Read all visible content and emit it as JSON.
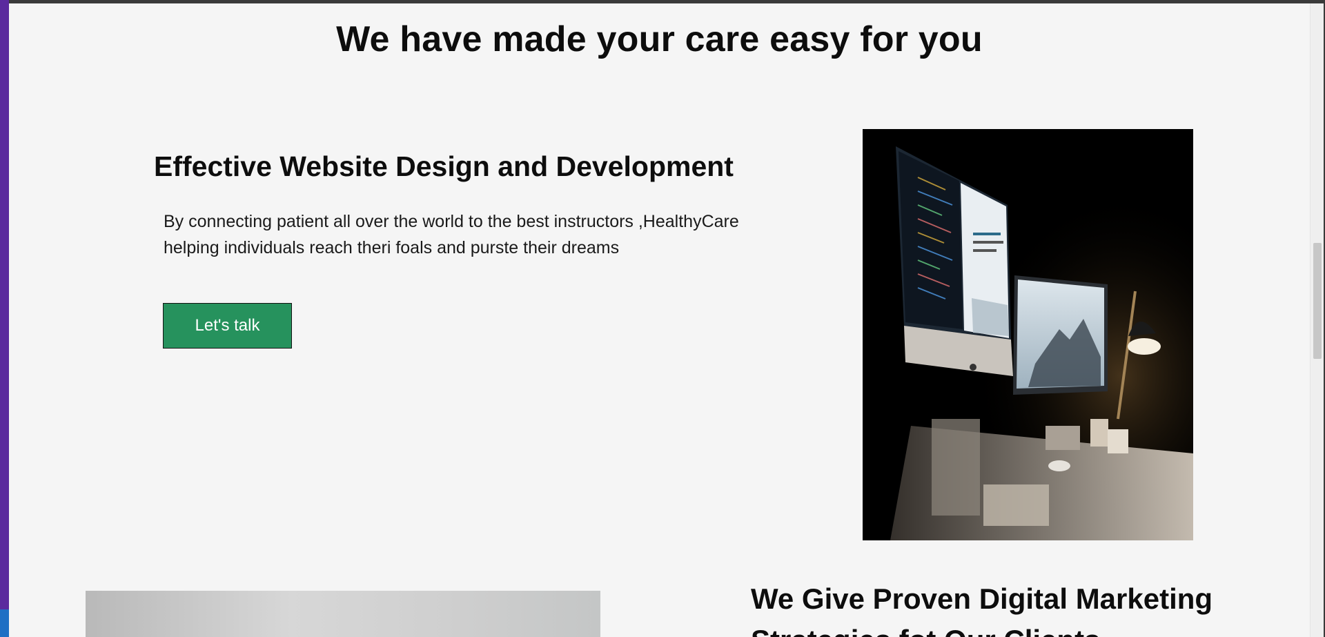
{
  "section": {
    "title": "We have made your care easy for you"
  },
  "feature": {
    "heading": "Effective Website Design and Development",
    "text": "By connecting patient all over the world to the best instructors ,HealthyCare helping individuals reach theri foals and purste their dreams",
    "button_label": "Let's talk"
  },
  "next_feature": {
    "heading": "We Give Proven Digital Marketing Strategies fot Our Clients"
  },
  "colors": {
    "button": "#26925d",
    "page_background": "#f5f5f5",
    "text": "#0d0d0d"
  }
}
